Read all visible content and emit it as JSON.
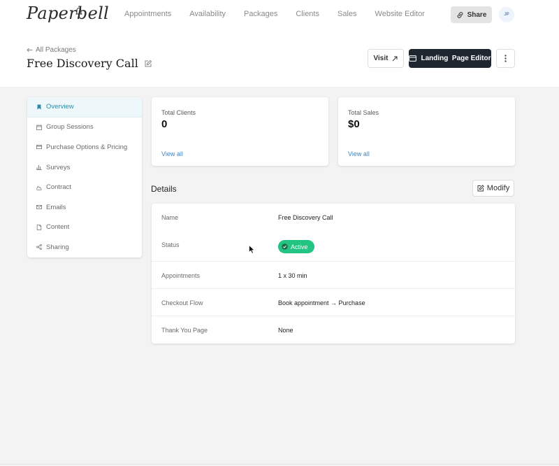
{
  "app": {
    "logo_text": "Paperbell"
  },
  "nav": {
    "items": [
      {
        "label": "Appointments"
      },
      {
        "label": "Availability"
      },
      {
        "label": "Packages"
      },
      {
        "label": "Clients"
      },
      {
        "label": "Sales"
      },
      {
        "label": "Website Editor"
      }
    ],
    "share_label": "Share",
    "avatar_initials": "JP"
  },
  "header": {
    "back_label": "All Packages",
    "title": "Free Discovery Call",
    "visit_label": "Visit",
    "landing_label": "Landing  Page Editor"
  },
  "sidebar": {
    "items": [
      {
        "label": "Overview"
      },
      {
        "label": "Group Sessions"
      },
      {
        "label": "Purchase Options & Pricing"
      },
      {
        "label": "Surveys"
      },
      {
        "label": "Contract"
      },
      {
        "label": "Emails"
      },
      {
        "label": "Content"
      },
      {
        "label": "Sharing"
      }
    ]
  },
  "stats": {
    "clients": {
      "label": "Total Clients",
      "value": "0",
      "link": "View all"
    },
    "sales": {
      "label": "Total Sales",
      "value": "$0",
      "link": "View all"
    }
  },
  "details": {
    "title": "Details",
    "modify_label": "Modify",
    "rows": {
      "name": {
        "label": "Name",
        "value": "Free Discovery Call"
      },
      "status": {
        "label": "Status",
        "value": "Active"
      },
      "appointments": {
        "label": "Appointments",
        "value": "1 x 30 min"
      },
      "checkout": {
        "label": "Checkout Flow",
        "value": "Book appointment → Purchase"
      },
      "thankyou": {
        "label": "Thank You Page",
        "value": "None"
      }
    }
  },
  "colors": {
    "accent": "#2e8aa8",
    "status_active": "#23c381",
    "primary_button": "#1e2630",
    "link": "#3a84c8"
  }
}
